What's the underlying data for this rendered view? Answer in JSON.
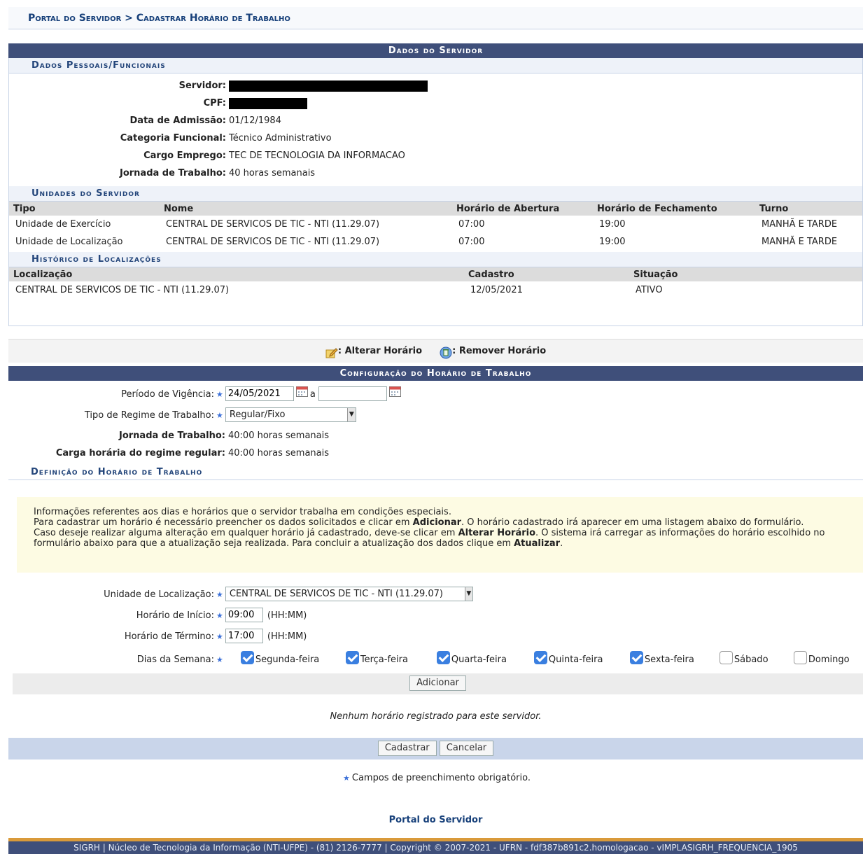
{
  "breadcrumb": "Portal do Servidor > Cadastrar Horário de Trabalho",
  "dados_servidor": {
    "title": "Dados do Servidor",
    "pessoais_title": "Dados Pessoais/Funcionais",
    "servidor_label": "Servidor:",
    "cpf_label": "CPF:",
    "admissao_label": "Data de Admissão:",
    "admissao_value": "01/12/1984",
    "categoria_label": "Categoria Funcional:",
    "categoria_value": "Técnico Administrativo",
    "cargo_label": "Cargo Emprego:",
    "cargo_value": "TEC DE TECNOLOGIA DA INFORMACAO",
    "jornada_label": "Jornada de Trabalho:",
    "jornada_value": "40 horas semanais"
  },
  "unidades": {
    "title": "Unidades do Servidor",
    "headers": [
      "Tipo",
      "Nome",
      "Horário de Abertura",
      "Horário de Fechamento",
      "Turno"
    ],
    "rows": [
      [
        "Unidade de Exercício",
        "CENTRAL DE SERVICOS DE TIC - NTI (11.29.07)",
        "07:00",
        "19:00",
        "MANHÃ E TARDE"
      ],
      [
        "Unidade de Localização",
        "CENTRAL DE SERVICOS DE TIC - NTI (11.29.07)",
        "07:00",
        "19:00",
        "MANHÃ E TARDE"
      ]
    ]
  },
  "historico": {
    "title": "Histórico de Localizações",
    "headers": [
      "Localização",
      "Cadastro",
      "Situação"
    ],
    "rows": [
      [
        "CENTRAL DE SERVICOS DE TIC - NTI (11.29.07)",
        "12/05/2021",
        "ATIVO"
      ]
    ]
  },
  "legend": {
    "alterar": ": Alterar Horário",
    "remover": ": Remover Horário"
  },
  "config": {
    "title": "Configuração do Horário de Trabalho",
    "periodo_label": "Período de Vigência:",
    "periodo_inicio": "24/05/2021",
    "periodo_sep": "a",
    "periodo_fim": "",
    "regime_label": "Tipo de Regime de Trabalho:",
    "regime_value": "Regular/Fixo",
    "jornada_label": "Jornada de Trabalho:",
    "jornada_value": "40:00 horas semanais",
    "carga_label": "Carga horária do regime regular:",
    "carga_value": "40:00 horas semanais"
  },
  "definicao": {
    "title": "Definição do Horário de Trabalho",
    "notice_l1": "Informações referentes aos dias e horários que o servidor trabalha em condições especiais.",
    "notice_l2a": "Para cadastrar um horário é necessário preencher os dados solicitados e clicar em ",
    "notice_l2b": "Adicionar",
    "notice_l2c": ". O horário cadastrado irá aparecer em uma listagem abaixo do formulário.",
    "notice_l3a": "Caso deseje realizar alguma alteração em qualquer horário já cadastrado, deve-se clicar em ",
    "notice_l3b": "Alterar Horário",
    "notice_l3c": ". O sistema irá carregar as informações do horário escolhido no formulário abaixo para que a atualização seja realizada. Para concluir a atualização dos dados clique em ",
    "notice_l3d": "Atualizar",
    "notice_l3e": ".",
    "unidade_label": "Unidade de Localização:",
    "unidade_value": "CENTRAL DE SERVICOS DE TIC - NTI (11.29.07)",
    "inicio_label": "Horário de Início:",
    "inicio_value": "09:00",
    "termino_label": "Horário de Término:",
    "termino_value": "17:00",
    "hhmm": "(HH:MM)",
    "dias_label": "Dias da Semana:",
    "dias": [
      {
        "label": "Segunda-feira",
        "checked": true
      },
      {
        "label": "Terça-feira",
        "checked": true
      },
      {
        "label": "Quarta-feira",
        "checked": true
      },
      {
        "label": "Quinta-feira",
        "checked": true
      },
      {
        "label": "Sexta-feira",
        "checked": true
      },
      {
        "label": "Sábado",
        "checked": false
      },
      {
        "label": "Domingo",
        "checked": false
      }
    ],
    "adicionar": "Adicionar",
    "empty_msg": "Nenhum horário registrado para este servidor."
  },
  "actions": {
    "cadastrar": "Cadastrar",
    "cancelar": "Cancelar"
  },
  "required_note": "Campos de preenchimento obrigatório.",
  "portal_link": "Portal do Servidor",
  "footer": "SIGRH | Núcleo de Tecnologia da Informação (NTI-UFPE) - (81) 2126-7777 | Copyright © 2007-2021 - UFRN - fdf387b891c2.homologacao - vIMPLASIGRH_FREQUENCIA_1905",
  "colors": {
    "header_bar": "#3f4f7a",
    "subheader_text": "#23457a",
    "notice_bg": "#fdfbe3",
    "checkbox": "#3a7fe0",
    "footer_accent": "#d99a3a"
  }
}
